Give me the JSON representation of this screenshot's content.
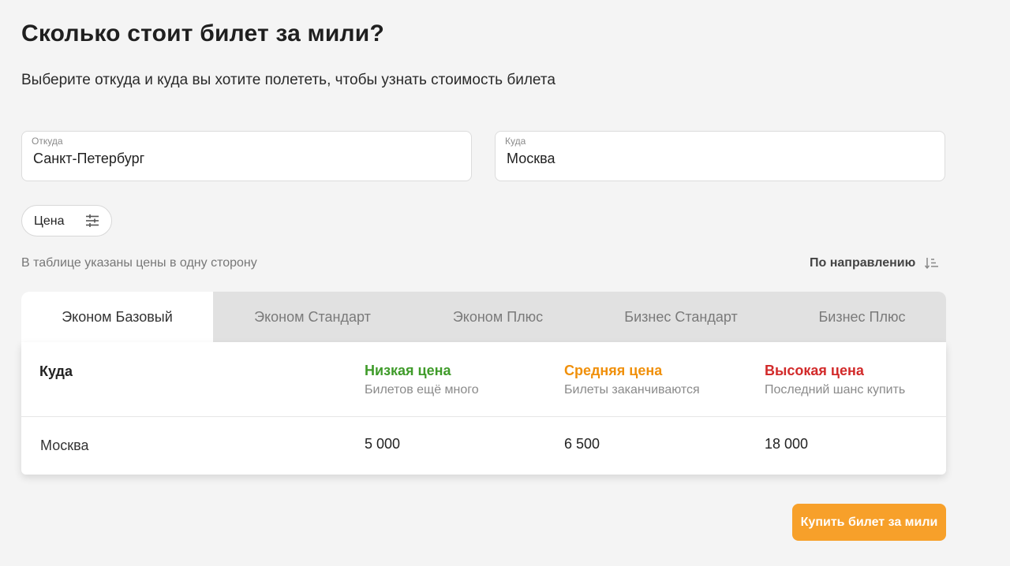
{
  "header": {
    "title": "Сколько стоит билет за мили?",
    "subtitle": "Выберите откуда и куда вы хотите полететь, чтобы узнать стоимость билета"
  },
  "search": {
    "from": {
      "label": "Откуда",
      "value": "Санкт-Петербург"
    },
    "to": {
      "label": "Куда",
      "value": "Москва"
    }
  },
  "filter": {
    "label": "Цена",
    "icon": "sliders-icon"
  },
  "note": "В таблице указаны цены в одну сторону",
  "sort": {
    "label": "По направлению",
    "icon": "sort-icon"
  },
  "tabs": [
    {
      "label": "Эконом Базовый",
      "active": true
    },
    {
      "label": "Эконом Стандарт",
      "active": false
    },
    {
      "label": "Эконом Плюс",
      "active": false
    },
    {
      "label": "Бизнес Стандарт",
      "active": false
    },
    {
      "label": "Бизнес Плюс",
      "active": false
    }
  ],
  "table": {
    "destination_header": "Куда",
    "columns": [
      {
        "title": "Низкая цена",
        "subtitle": "Билетов ещё много",
        "color": "#3f9b2a"
      },
      {
        "title": "Средняя цена",
        "subtitle": "Билеты заканчиваются",
        "color": "#f0900b"
      },
      {
        "title": "Высокая цена",
        "subtitle": "Последний шанс купить",
        "color": "#d22a2a"
      }
    ],
    "rows": [
      {
        "destination": "Москва",
        "values": [
          "5 000",
          "6 500",
          "18 000"
        ]
      }
    ]
  },
  "buy_button": {
    "label": "Купить билет за мили",
    "color": "#f7a02a"
  }
}
